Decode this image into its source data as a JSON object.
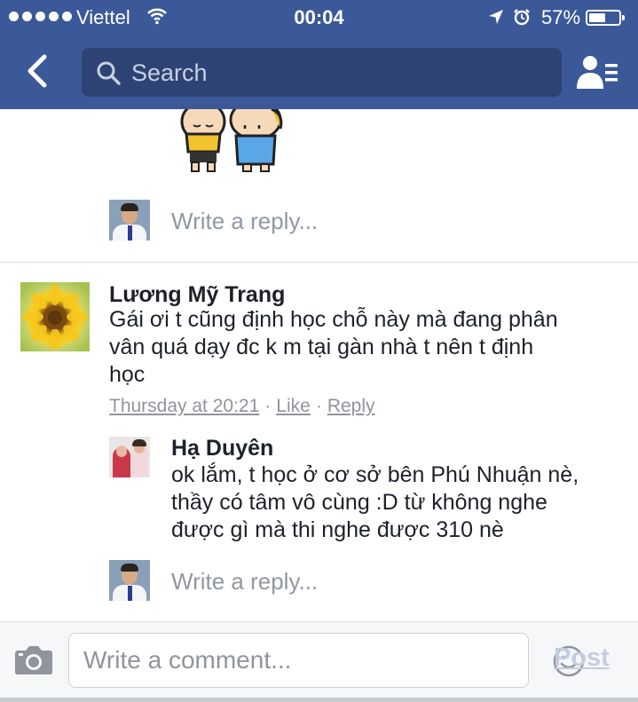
{
  "status_bar": {
    "carrier": "Viettel",
    "time": "00:04",
    "battery": "57%",
    "battery_level": 0.57,
    "icons": [
      "signal-dots-icon",
      "wifi-icon",
      "location-arrow-icon",
      "alarm-icon",
      "battery-icon"
    ]
  },
  "nav": {
    "back_icon": "chevron-left-icon",
    "search_placeholder": "Search",
    "friends_icon": "friend-list-icon"
  },
  "thread": {
    "reply_placeholder": "Write a reply...",
    "comment": {
      "author": "Lương Mỹ Trang",
      "text": "Gái ơi t cũng định học chỗ này mà đang phân\nvân quá dạy đc k m tại gàn nhà t nên t định\nhọc",
      "time": "Thursday at 20:21",
      "separator": "·",
      "like": "Like",
      "reply": "Reply"
    },
    "nested_reply": {
      "author": "Hạ Duyên",
      "text": "ok lắm, t học ở cơ sở bên Phú Nhuận nè,\nthầy có tâm vô cùng :D từ không nghe\nđược gì mà thi nghe được 310 nè"
    }
  },
  "composer": {
    "placeholder": "Write a comment...",
    "post_label": "Post",
    "camera_icon": "camera-icon",
    "emoji_icon": "smiley-icon"
  },
  "colors": {
    "header": "#3b5998",
    "search_field": "#2d4373",
    "text": "#1d2129",
    "meta": "#90949c",
    "post_disabled": "#c4cde0"
  }
}
